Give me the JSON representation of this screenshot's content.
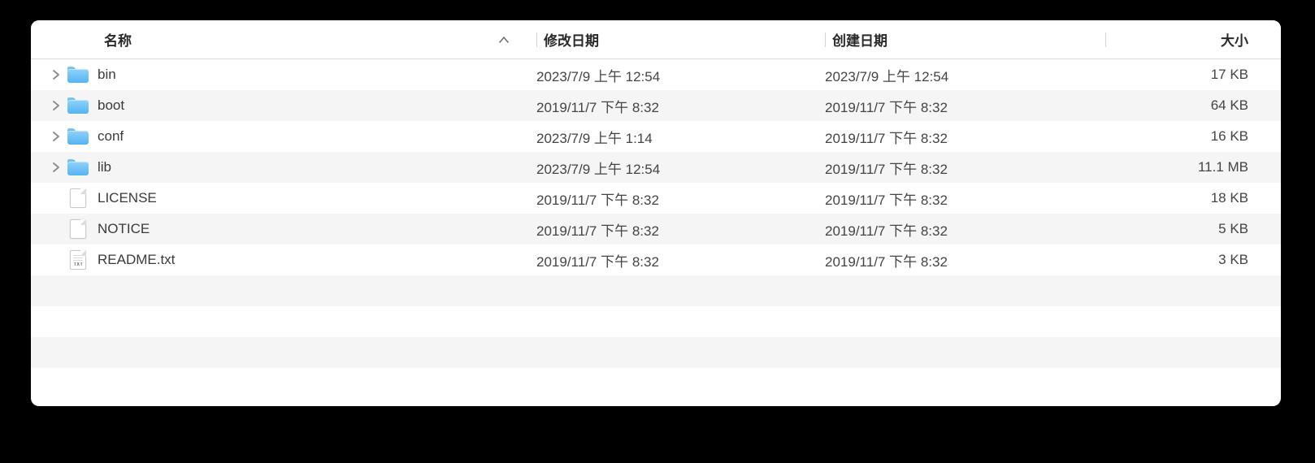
{
  "columns": {
    "name": "名称",
    "modified": "修改日期",
    "created": "创建日期",
    "size": "大小"
  },
  "sort": {
    "column": "name",
    "ascending": true
  },
  "rows": [
    {
      "type": "folder",
      "name": "bin",
      "modified": "2023/7/9 上午 12:54",
      "created": "2023/7/9 上午 12:54",
      "size": "17 KB",
      "expandable": true
    },
    {
      "type": "folder",
      "name": "boot",
      "modified": "2019/11/7 下午 8:32",
      "created": "2019/11/7 下午 8:32",
      "size": "64 KB",
      "expandable": true
    },
    {
      "type": "folder",
      "name": "conf",
      "modified": "2023/7/9 上午 1:14",
      "created": "2019/11/7 下午 8:32",
      "size": "16 KB",
      "expandable": true
    },
    {
      "type": "folder",
      "name": "lib",
      "modified": "2023/7/9 上午 12:54",
      "created": "2019/11/7 下午 8:32",
      "size": "11.1 MB",
      "expandable": true
    },
    {
      "type": "file",
      "name": "LICENSE",
      "modified": "2019/11/7 下午 8:32",
      "created": "2019/11/7 下午 8:32",
      "size": "18 KB",
      "expandable": false
    },
    {
      "type": "file",
      "name": "NOTICE",
      "modified": "2019/11/7 下午 8:32",
      "created": "2019/11/7 下午 8:32",
      "size": "5 KB",
      "expandable": false
    },
    {
      "type": "txt",
      "name": "README.txt",
      "modified": "2019/11/7 下午 8:32",
      "created": "2019/11/7 下午 8:32",
      "size": "3 KB",
      "expandable": false
    }
  ]
}
